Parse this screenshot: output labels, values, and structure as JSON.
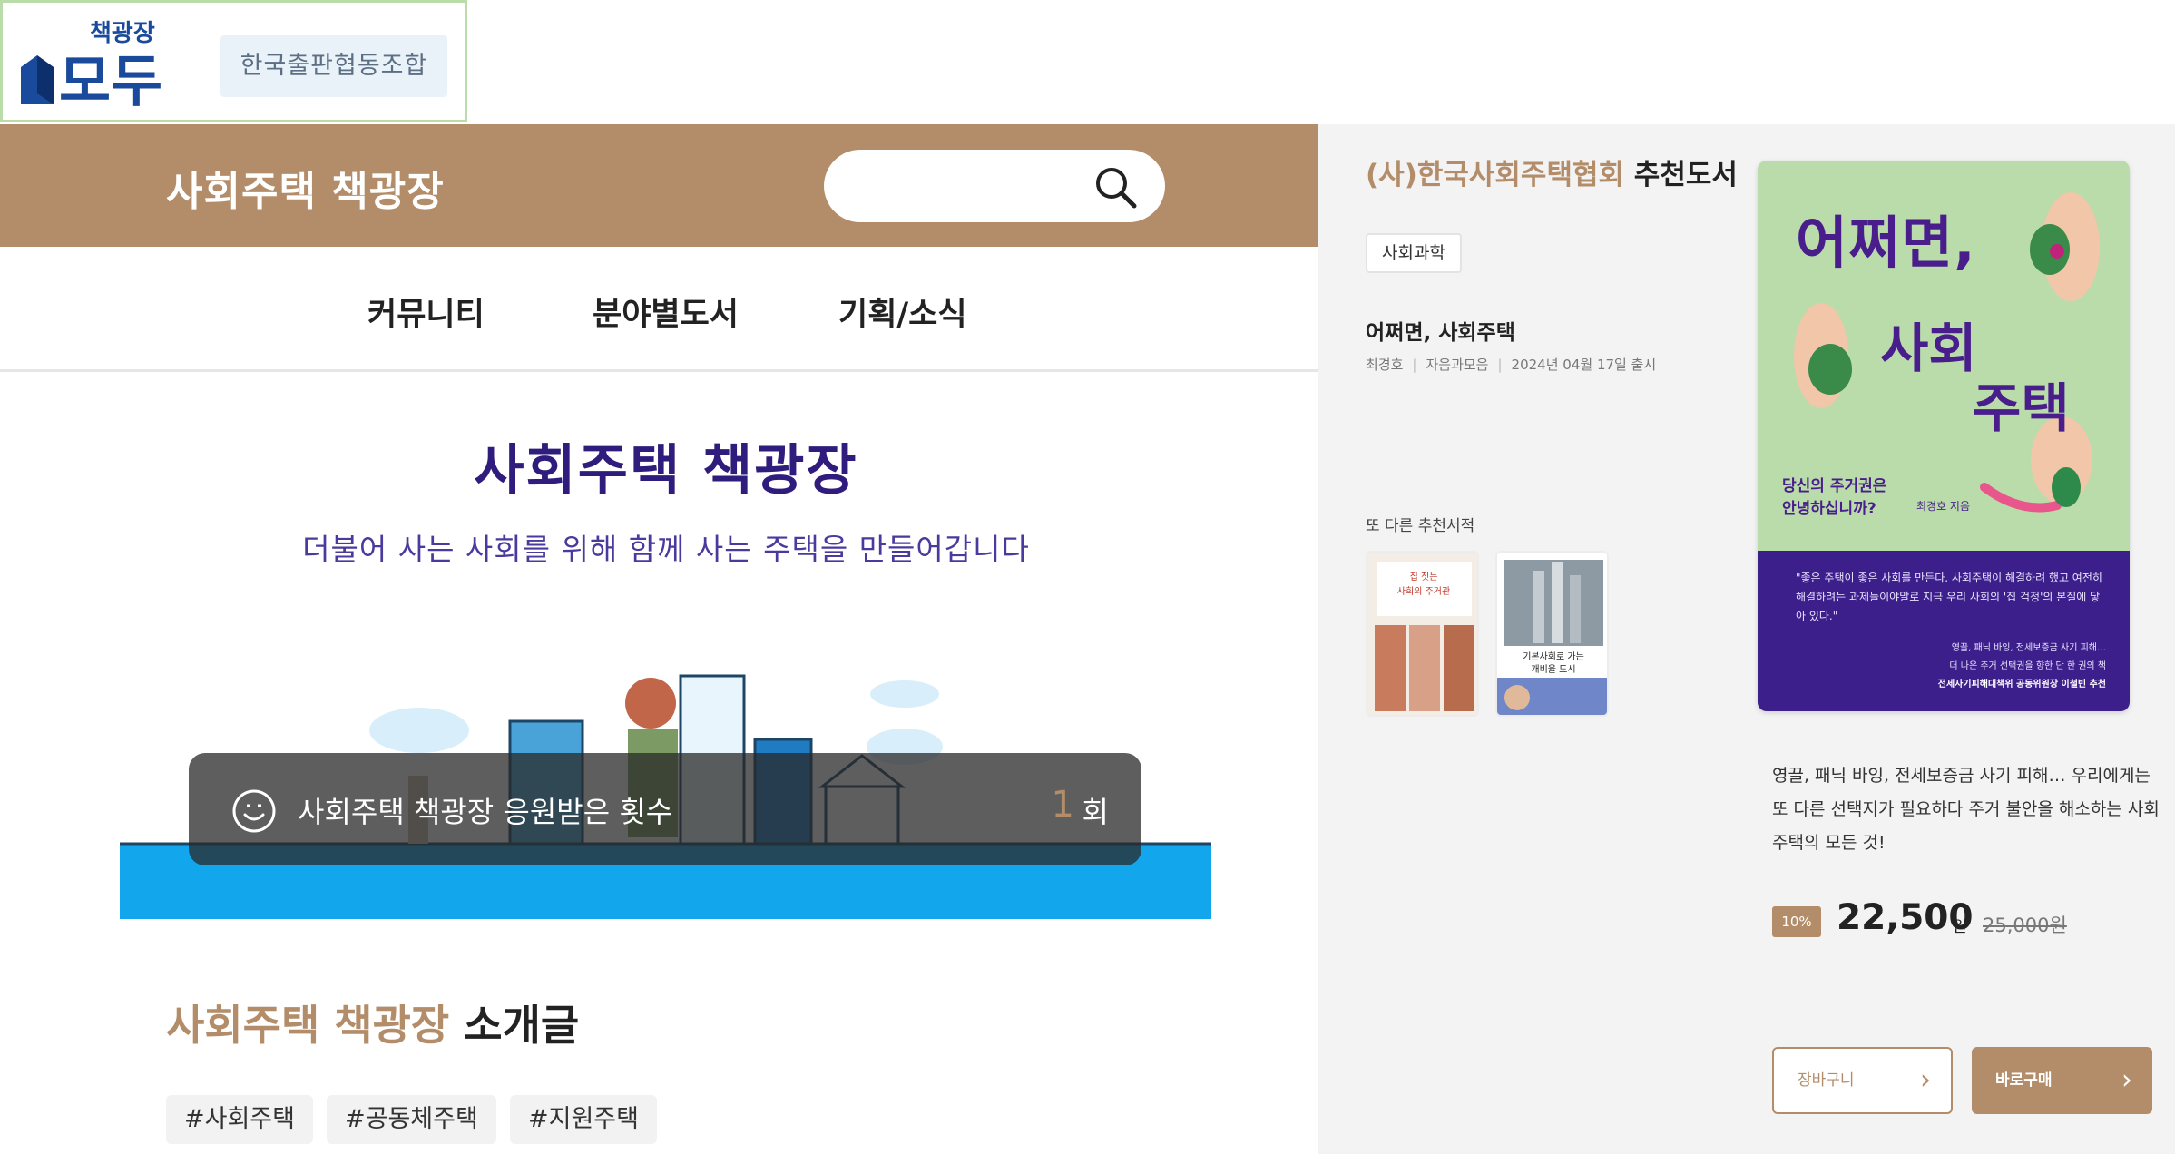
{
  "header": {
    "logo_text": "책광장 모두",
    "publisher_badge": "한국출판협동조합"
  },
  "brand": {
    "title": "사회주택 책광장",
    "search_placeholder": ""
  },
  "nav": {
    "items": [
      "커뮤니티",
      "분야별도서",
      "기획/소식"
    ]
  },
  "hero": {
    "title": "사회주택 책광장",
    "subtitle": "더불어 사는 사회를 위해 함께 사는 주택을 만들어갑니다",
    "counter_label": "사회주택 책광장 응원받은 횟수",
    "counter_value": "1",
    "counter_unit": "회"
  },
  "intro": {
    "title_accent": "사회주택 책광장",
    "title_rest": " 소개글",
    "tags": [
      "#사회주택",
      "#공동체주택",
      "#지원주택"
    ]
  },
  "recommend": {
    "org": "(사)한국사회주택협회",
    "title_rest": " 추천도서",
    "category": "사회과학",
    "book_title": "어쩌면, 사회주택",
    "author": "최경호",
    "publisher": "자음과모음",
    "release": "2024년 04월 17일 출시",
    "other_label": "또 다른 추천서적",
    "other_books": [
      {
        "title_line1": "집 짓는",
        "title_line2": "사회의 주거관"
      },
      {
        "title_line1": "기본사회로 가는",
        "title_line2": "개비율 도시"
      }
    ],
    "cover": {
      "line1": "어쩌면,",
      "line2": "사회",
      "line3": "주택",
      "tagline1": "당신의 주거권은",
      "tagline2": "안녕하십니까?",
      "author_note": "최경호 지음",
      "blurb": "\"좋은 주택이 좋은 사회를 만든다. 사회주택이 해결하려 했고 여전히 해결하려는 과제들이야말로 지금 우리 사회의 '집 걱정'의 본질에 닿아 있다.\"",
      "rec_line1": "영끌, 패닉 바잉, 전세보증금 사기 피해…",
      "rec_line2": "더 나은 주거 선택권을 향한 단 한 권의 책",
      "rec_line3": "전세사기피해대책위 공동위원장 이철빈 추천"
    },
    "description": "영끌, 패닉 바잉, 전세보증금 사기 피해… 우리에게는 또 다른 선택지가 필요하다 주거 불안을 해소하는 사회주택의 모든 것!",
    "discount": "10%",
    "price": "22,500",
    "price_unit": "원",
    "original_price": "25,000원",
    "cart_label": "장바구니",
    "buy_label": "바로구매"
  },
  "colors": {
    "brand_brown": "#b38d69",
    "hero_purple": "#2f1c7c",
    "cover_green": "#b9dcaa",
    "cover_purple": "#3d1f8c",
    "sky_blue": "#12a7ec"
  },
  "icons": {
    "search": "search-icon",
    "smile": "smile-icon",
    "chevron": "chevron-right-icon"
  }
}
